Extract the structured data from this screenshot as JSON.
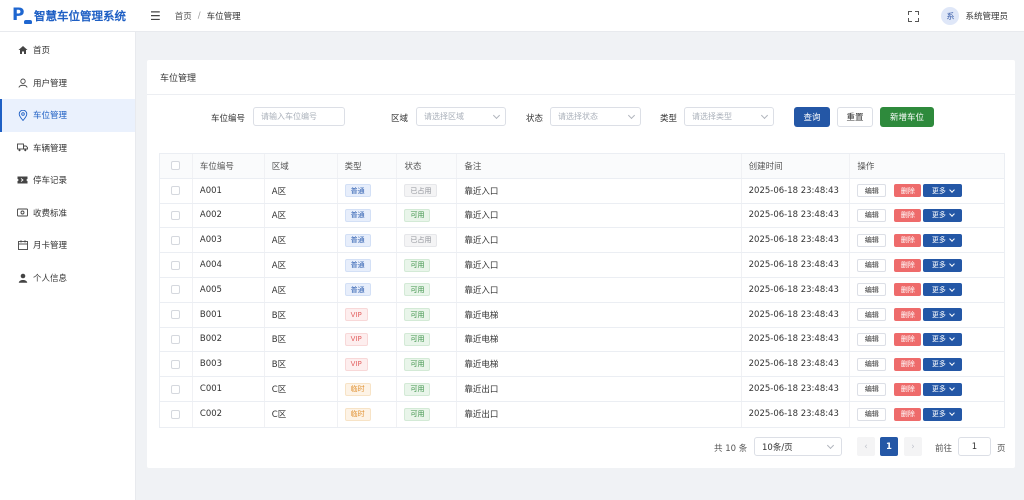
{
  "app": {
    "title": "智慧车位管理系统"
  },
  "breadcrumb": {
    "home": "首页",
    "separator": "/",
    "current": "车位管理"
  },
  "user": {
    "avatar_text": "系",
    "name": "系统管理员"
  },
  "sidebar": {
    "items": [
      {
        "label": "首页",
        "icon": "home-icon"
      },
      {
        "label": "用户管理",
        "icon": "user-icon"
      },
      {
        "label": "车位管理",
        "icon": "location-pin-icon",
        "active": true
      },
      {
        "label": "车辆管理",
        "icon": "truck-icon"
      },
      {
        "label": "停车记录",
        "icon": "ticket-icon"
      },
      {
        "label": "收费标准",
        "icon": "money-icon"
      },
      {
        "label": "月卡管理",
        "icon": "calendar-icon"
      },
      {
        "label": "个人信息",
        "icon": "person-icon"
      }
    ]
  },
  "page": {
    "title": "车位管理"
  },
  "filters": {
    "space_no": {
      "label": "车位编号",
      "placeholder": "请输入车位编号"
    },
    "area": {
      "label": "区域",
      "placeholder": "请选择区域"
    },
    "status": {
      "label": "状态",
      "placeholder": "请选择状态"
    },
    "type": {
      "label": "类型",
      "placeholder": "请选择类型"
    },
    "search_label": "查询",
    "reset_label": "重置",
    "add_label": "新增车位"
  },
  "table": {
    "headers": [
      "车位编号",
      "区域",
      "类型",
      "状态",
      "备注",
      "创建时间",
      "操作"
    ],
    "actions": {
      "edit": "编辑",
      "delete": "删除",
      "more": "更多"
    },
    "rows": [
      {
        "no": "A001",
        "area": "A区",
        "type": "普通",
        "status": "已占用",
        "note": "靠近入口",
        "created": "2025-06-18 23:48:43"
      },
      {
        "no": "A002",
        "area": "A区",
        "type": "普通",
        "status": "可用",
        "note": "靠近入口",
        "created": "2025-06-18 23:48:43"
      },
      {
        "no": "A003",
        "area": "A区",
        "type": "普通",
        "status": "已占用",
        "note": "靠近入口",
        "created": "2025-06-18 23:48:43"
      },
      {
        "no": "A004",
        "area": "A区",
        "type": "普通",
        "status": "可用",
        "note": "靠近入口",
        "created": "2025-06-18 23:48:43"
      },
      {
        "no": "A005",
        "area": "A区",
        "type": "普通",
        "status": "可用",
        "note": "靠近入口",
        "created": "2025-06-18 23:48:43"
      },
      {
        "no": "B001",
        "area": "B区",
        "type": "VIP",
        "status": "可用",
        "note": "靠近电梯",
        "created": "2025-06-18 23:48:43"
      },
      {
        "no": "B002",
        "area": "B区",
        "type": "VIP",
        "status": "可用",
        "note": "靠近电梯",
        "created": "2025-06-18 23:48:43"
      },
      {
        "no": "B003",
        "area": "B区",
        "type": "VIP",
        "status": "可用",
        "note": "靠近电梯",
        "created": "2025-06-18 23:48:43"
      },
      {
        "no": "C001",
        "area": "C区",
        "type": "临时",
        "status": "可用",
        "note": "靠近出口",
        "created": "2025-06-18 23:48:43"
      },
      {
        "no": "C002",
        "area": "C区",
        "type": "临时",
        "status": "可用",
        "note": "靠近出口",
        "created": "2025-06-18 23:48:43"
      }
    ]
  },
  "pagination": {
    "total_text": "共 10 条",
    "page_size": "10条/页",
    "prev": "‹",
    "current_page": "1",
    "next": "›",
    "goto_label": "前往",
    "jump_value": "1",
    "page_suffix": "页"
  },
  "colors": {
    "primary": "#2457a6",
    "success": "#2e8a3c",
    "danger": "#ee6b6b",
    "brand": "#1e5fc4"
  }
}
